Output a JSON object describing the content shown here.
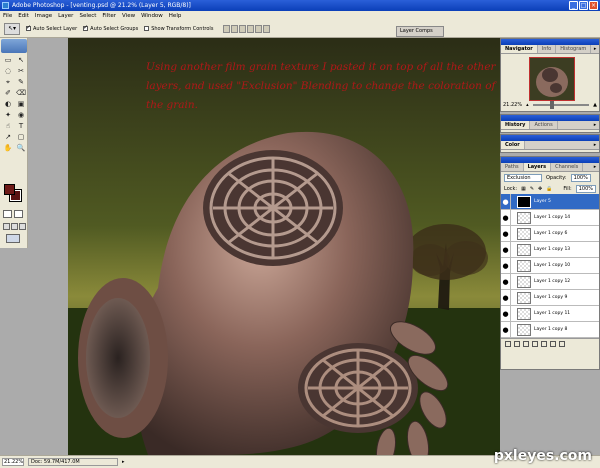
{
  "window": {
    "title": "Adobe Photoshop - [venting.psd @ 21.2% (Layer 5, RGB/8)]",
    "controls": [
      "_",
      "□",
      "×"
    ]
  },
  "menu": [
    "File",
    "Edit",
    "Image",
    "Layer",
    "Select",
    "Filter",
    "View",
    "Window",
    "Help"
  ],
  "options_bar": {
    "auto_select_layer": "Auto Select Layer",
    "auto_select_groups": "Auto Select Groups",
    "show_transform_controls": "Show Transform Controls",
    "layer_comps_tab": "Layer Comps"
  },
  "toolbox": {
    "tools": [
      "▭",
      "↖",
      "◌",
      "✂",
      "⌖",
      "✎",
      "✐",
      "⌫",
      "◐",
      "▣",
      "✦",
      "◉",
      "☝",
      "T",
      "↗",
      "▢",
      "✋",
      "🔍"
    ],
    "foreground_color": "#6e1a18",
    "background_color": "#5a1212"
  },
  "caption": "Using another film grain texture I pasted it on top of all the other layers, and used \"Exclusion\" Blending to change the coloration of the grain.",
  "navigator_panel": {
    "tabs": [
      "Navigator",
      "Info",
      "Histogram"
    ],
    "zoom": "21.22%"
  },
  "history_panel": {
    "tabs": [
      "History",
      "Actions"
    ]
  },
  "color_panel": {
    "tabs": [
      "Color"
    ]
  },
  "layers_panel": {
    "tabs": [
      "Paths",
      "Layers",
      "Channels"
    ],
    "blend_mode": "Exclusion",
    "opacity_label": "Opacity:",
    "opacity_value": "100%",
    "lock_label": "Lock:",
    "fill_label": "Fill:",
    "fill_value": "100%",
    "layers": [
      {
        "name": "Layer 5",
        "selected": true
      },
      {
        "name": "Layer 1 copy 14",
        "selected": false
      },
      {
        "name": "Layer 1 copy 6",
        "selected": false
      },
      {
        "name": "Layer 1 copy 13",
        "selected": false
      },
      {
        "name": "Layer 1 copy 10",
        "selected": false
      },
      {
        "name": "Layer 1 copy 12",
        "selected": false
      },
      {
        "name": "Layer 1 copy 9",
        "selected": false
      },
      {
        "name": "Layer 1 copy 11",
        "selected": false
      },
      {
        "name": "Layer 1 copy 8",
        "selected": false
      }
    ]
  },
  "status_bar": {
    "zoom": "21.22%",
    "doc_info": "Doc: 59.7M/417.0M"
  },
  "watermark": "pxleyes.com"
}
